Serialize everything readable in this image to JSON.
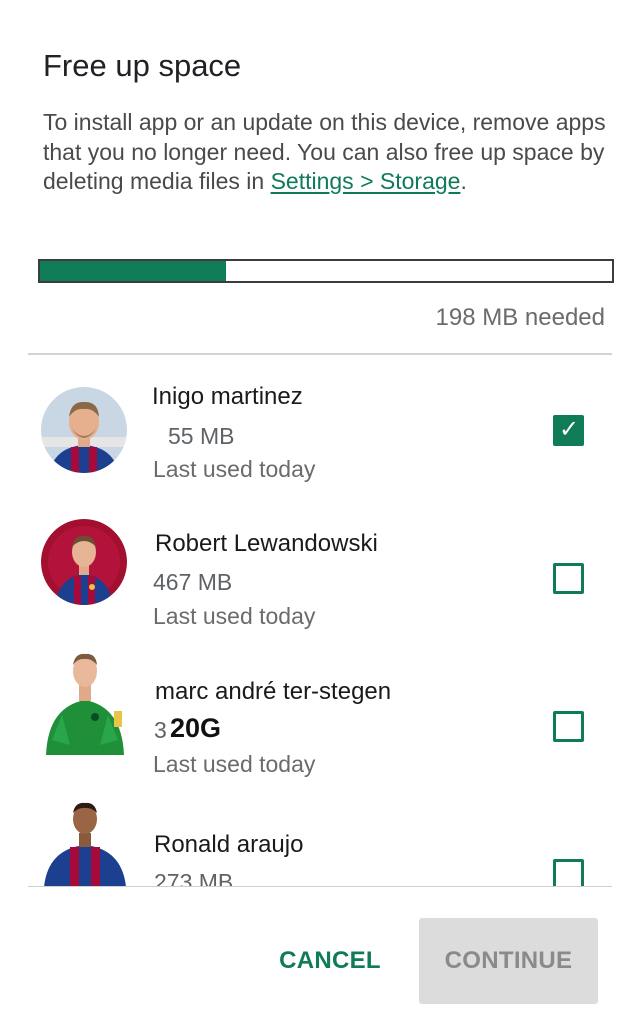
{
  "dialog": {
    "title": "Free up space",
    "description_prefix": "To install app or an update on this device, remove apps that you no longer need. You can also free up space by deleting media files in ",
    "settings_link": "Settings > Storage",
    "description_suffix": ".",
    "progress_fraction": 0.325,
    "needed_label": "198 MB needed"
  },
  "apps": [
    {
      "name": "Inigo martinez",
      "size": "55 MB",
      "last_used": "Last used today",
      "checked": true,
      "avatar_icon": "player-avatar"
    },
    {
      "name": "Robert Lewandowski",
      "size": "467 MB",
      "last_used": "Last used today",
      "checked": false,
      "avatar_icon": "player-avatar"
    },
    {
      "name": "marc andré ter-stegen",
      "size": "3",
      "size_overlay": "20G",
      "last_used": "Last used today",
      "checked": false,
      "avatar_icon": "goalkeeper-avatar"
    },
    {
      "name": "Ronald araujo",
      "size": "273 MB",
      "last_used": "",
      "checked": false,
      "avatar_icon": "player-avatar"
    }
  ],
  "buttons": {
    "cancel": "CANCEL",
    "continue": "CONTINUE"
  },
  "colors": {
    "accent": "#0f7b57",
    "link": "#0f7a5a",
    "disabled_bg": "#dcdcdc",
    "jersey_blue": "#1d3f8f",
    "jersey_red": "#a50a3a",
    "keeper_green": "#1f8f3a"
  },
  "checkmark": "✓"
}
